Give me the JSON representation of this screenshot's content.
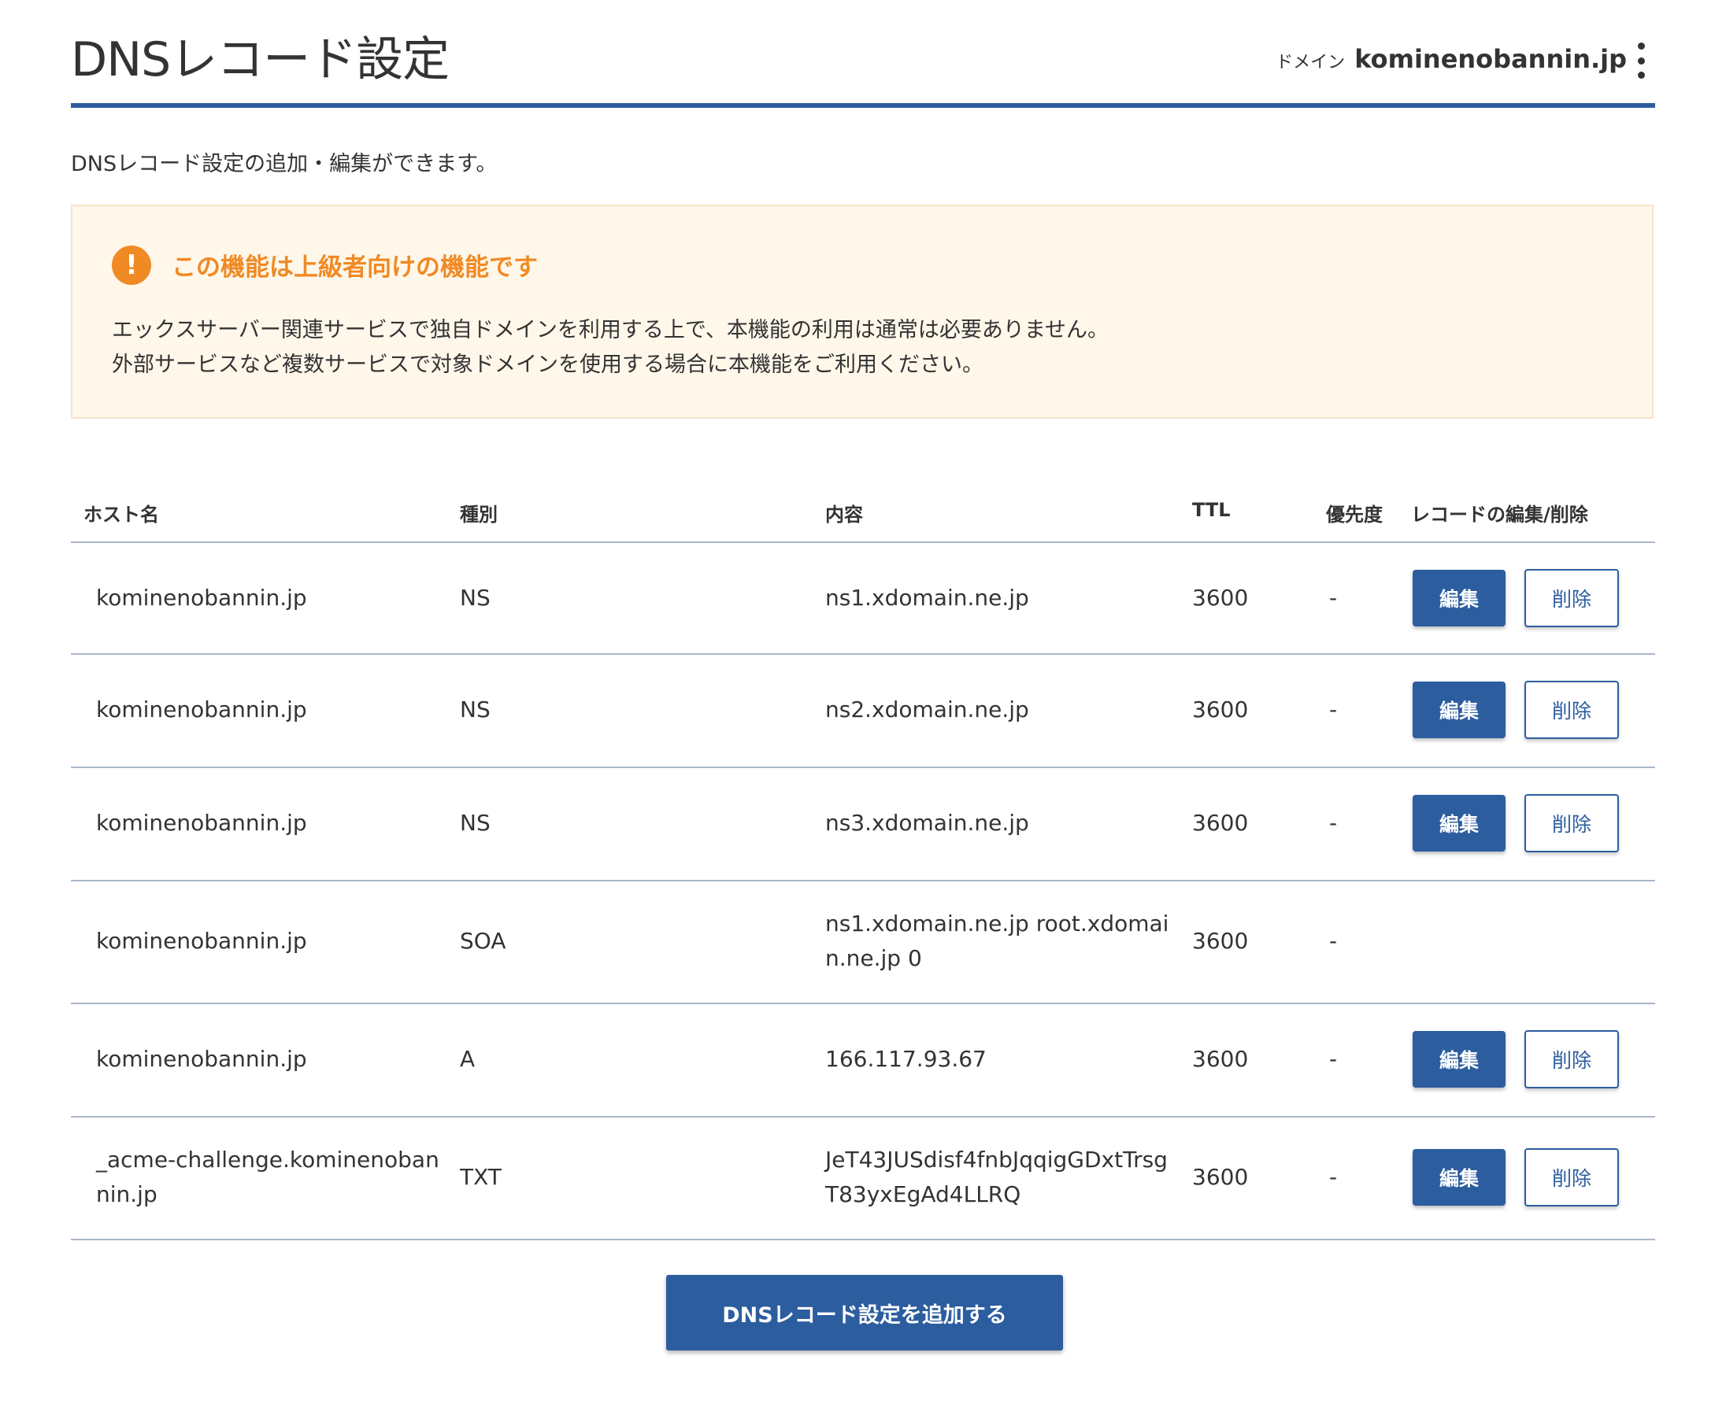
{
  "header": {
    "title": "DNSレコード設定",
    "domain_prefix": "ドメイン",
    "domain_name": "kominenobannin.jp",
    "more_icon": "vertical-ellipsis-icon"
  },
  "intro": "DNSレコード設定の追加・編集ができます。",
  "warning": {
    "icon": "exclamation-icon",
    "icon_glyph": "!",
    "title": "この機能は上級者向けの機能です",
    "line1": "エックスサーバー関連サービスで独自ドメインを利用する上で、本機能の利用は通常は必要ありません。",
    "line2": "外部サービスなど複数サービスで対象ドメインを使用する場合に本機能をご利用ください。",
    "accent_color": "#f08a24"
  },
  "table": {
    "headers": {
      "host": "ホスト名",
      "type": "種別",
      "content": "内容",
      "ttl": "TTL",
      "priority": "優先度",
      "actions": "レコードの編集/削除"
    },
    "rows": [
      {
        "host": "kominenobannin.jp",
        "type": "NS",
        "content": "ns1.xdomain.ne.jp",
        "ttl": "3600",
        "priority": "-",
        "edit": "編集",
        "delete": "削除"
      },
      {
        "host": "kominenobannin.jp",
        "type": "NS",
        "content": "ns2.xdomain.ne.jp",
        "ttl": "3600",
        "priority": "-",
        "edit": "編集",
        "delete": "削除"
      },
      {
        "host": "kominenobannin.jp",
        "type": "NS",
        "content": "ns3.xdomain.ne.jp",
        "ttl": "3600",
        "priority": "-",
        "edit": "編集",
        "delete": "削除"
      },
      {
        "host": "kominenobannin.jp",
        "type": "SOA",
        "content": "ns1.xdomain.ne.jp root.xdomain.ne.jp 0",
        "ttl": "3600",
        "priority": "-"
      },
      {
        "host": "kominenobannin.jp",
        "type": "A",
        "content": "166.117.93.67",
        "ttl": "3600",
        "priority": "-",
        "edit": "編集",
        "delete": "削除"
      },
      {
        "host": "_acme-challenge.kominenobannin.jp",
        "type": "TXT",
        "content": "JeT43JUSdisf4fnbJqqigGDxtTrsgT83yxEgAd4LLRQ",
        "ttl": "3600",
        "priority": "-",
        "edit": "編集",
        "delete": "削除"
      }
    ]
  },
  "add_button": "DNSレコード設定を追加する",
  "colors": {
    "primary": "#2c5d9f",
    "warning_bg": "#fff7ea",
    "warning_accent": "#f08a24"
  }
}
